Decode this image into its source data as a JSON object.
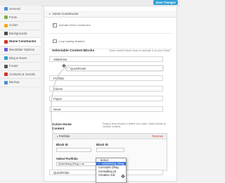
{
  "toolbar": {
    "save_label": "Save Changes"
  },
  "sidebar": {
    "items": [
      {
        "label": "General",
        "color": "#4a90d9"
      },
      {
        "label": "Fonts",
        "color": "#7cb342"
      },
      {
        "label": "Colors",
        "color": "#f5a623"
      },
      {
        "label": "Backgrounds",
        "color": "#4a4a4a"
      },
      {
        "label": "Home Constructor",
        "color": "#d0342c"
      },
      {
        "label": "MeoSlider Options",
        "color": "#6a5acd"
      },
      {
        "label": "Blog & News",
        "color": "#2e9fd6"
      },
      {
        "label": "Footer",
        "color": "#555555"
      },
      {
        "label": "Contacts & Socials",
        "color": "#d0342c"
      },
      {
        "label": "Backup",
        "color": "#4a90d9"
      }
    ]
  },
  "main": {
    "section_title": "Home Constructor",
    "activate_label": "Activate Home Constructor",
    "loop_label": "Loop loading disabled",
    "blocks_title": "Selectable Content Blocks",
    "blocks_hint": "Move content block down to activate it on your Home",
    "blocks": [
      "Slideshow",
      "QuickFinder",
      "Portfolio",
      "Clients",
      "Pages",
      "News"
    ],
    "active_title_1": "Active Home",
    "active_title_2": "Content",
    "active_hint": "Drag & drop blocks to define sort order. Open blocks to choose content.",
    "active_block": {
      "name": "Portfolio",
      "remove_label": "Remove",
      "block_id_label": "Block ID",
      "block_id_label_2": "Block ID",
      "select_portfolio_label": "Select Portfolio",
      "select_value": "Advertising (Slug = ac"
    },
    "dropdown_options": [
      "- Select -",
      "Advertising (Slug",
      "Concepts (Slug",
      "Consulting (S",
      "Creative Adv"
    ],
    "dropdown_selected": 1,
    "bottom_block": "QuickFinder"
  }
}
